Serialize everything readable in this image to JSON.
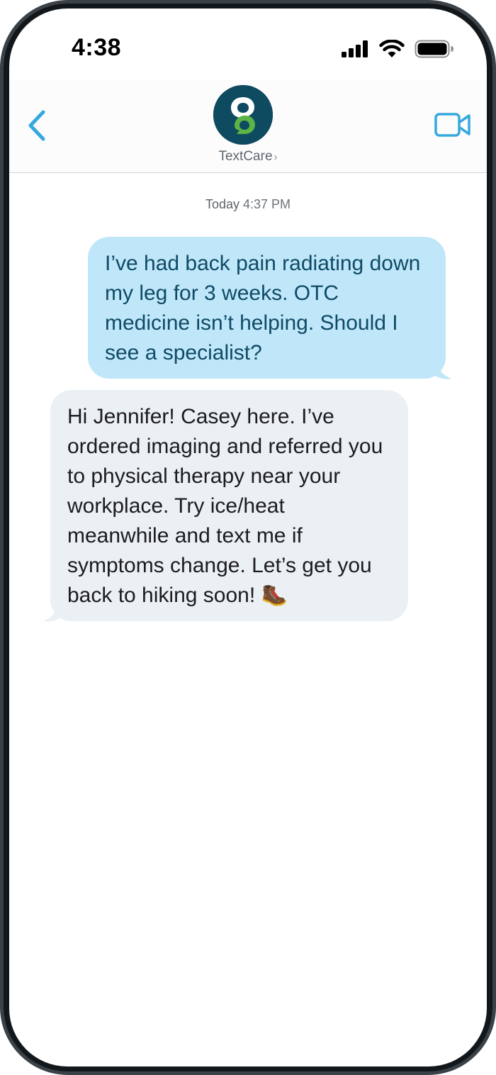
{
  "status_bar": {
    "time": "4:38",
    "icons": [
      "cellular-signal-icon",
      "wifi-icon",
      "battery-icon"
    ]
  },
  "header": {
    "back_icon": "chevron-left-icon",
    "contact_name": "TextCare",
    "contact_chevron": "›",
    "avatar_icon": "textcare-logo-icon",
    "video_icon": "video-camera-icon"
  },
  "conversation": {
    "timestamp_day": "Today",
    "timestamp_time": "4:37 PM",
    "messages": [
      {
        "direction": "outgoing",
        "text": "I’ve had back pain radiating down my leg for 3 weeks. OTC medicine isn’t helping. Should I see a specialist?"
      },
      {
        "direction": "incoming",
        "text": "Hi Jennifer! Casey here. I’ve ordered imaging and referred you to physical therapy near your workplace. Try ice/heat meanwhile and text me if symptoms change. Let’s get you back to hiking soon!",
        "emoji": "🥾"
      }
    ]
  },
  "colors": {
    "accent": "#35a9dd",
    "outgoing_bubble": "#bfe7f9",
    "outgoing_text": "#0f4a66",
    "incoming_bubble": "#ebf0f4",
    "avatar_bg": "#0e4a60",
    "logo_green": "#5bb445"
  }
}
